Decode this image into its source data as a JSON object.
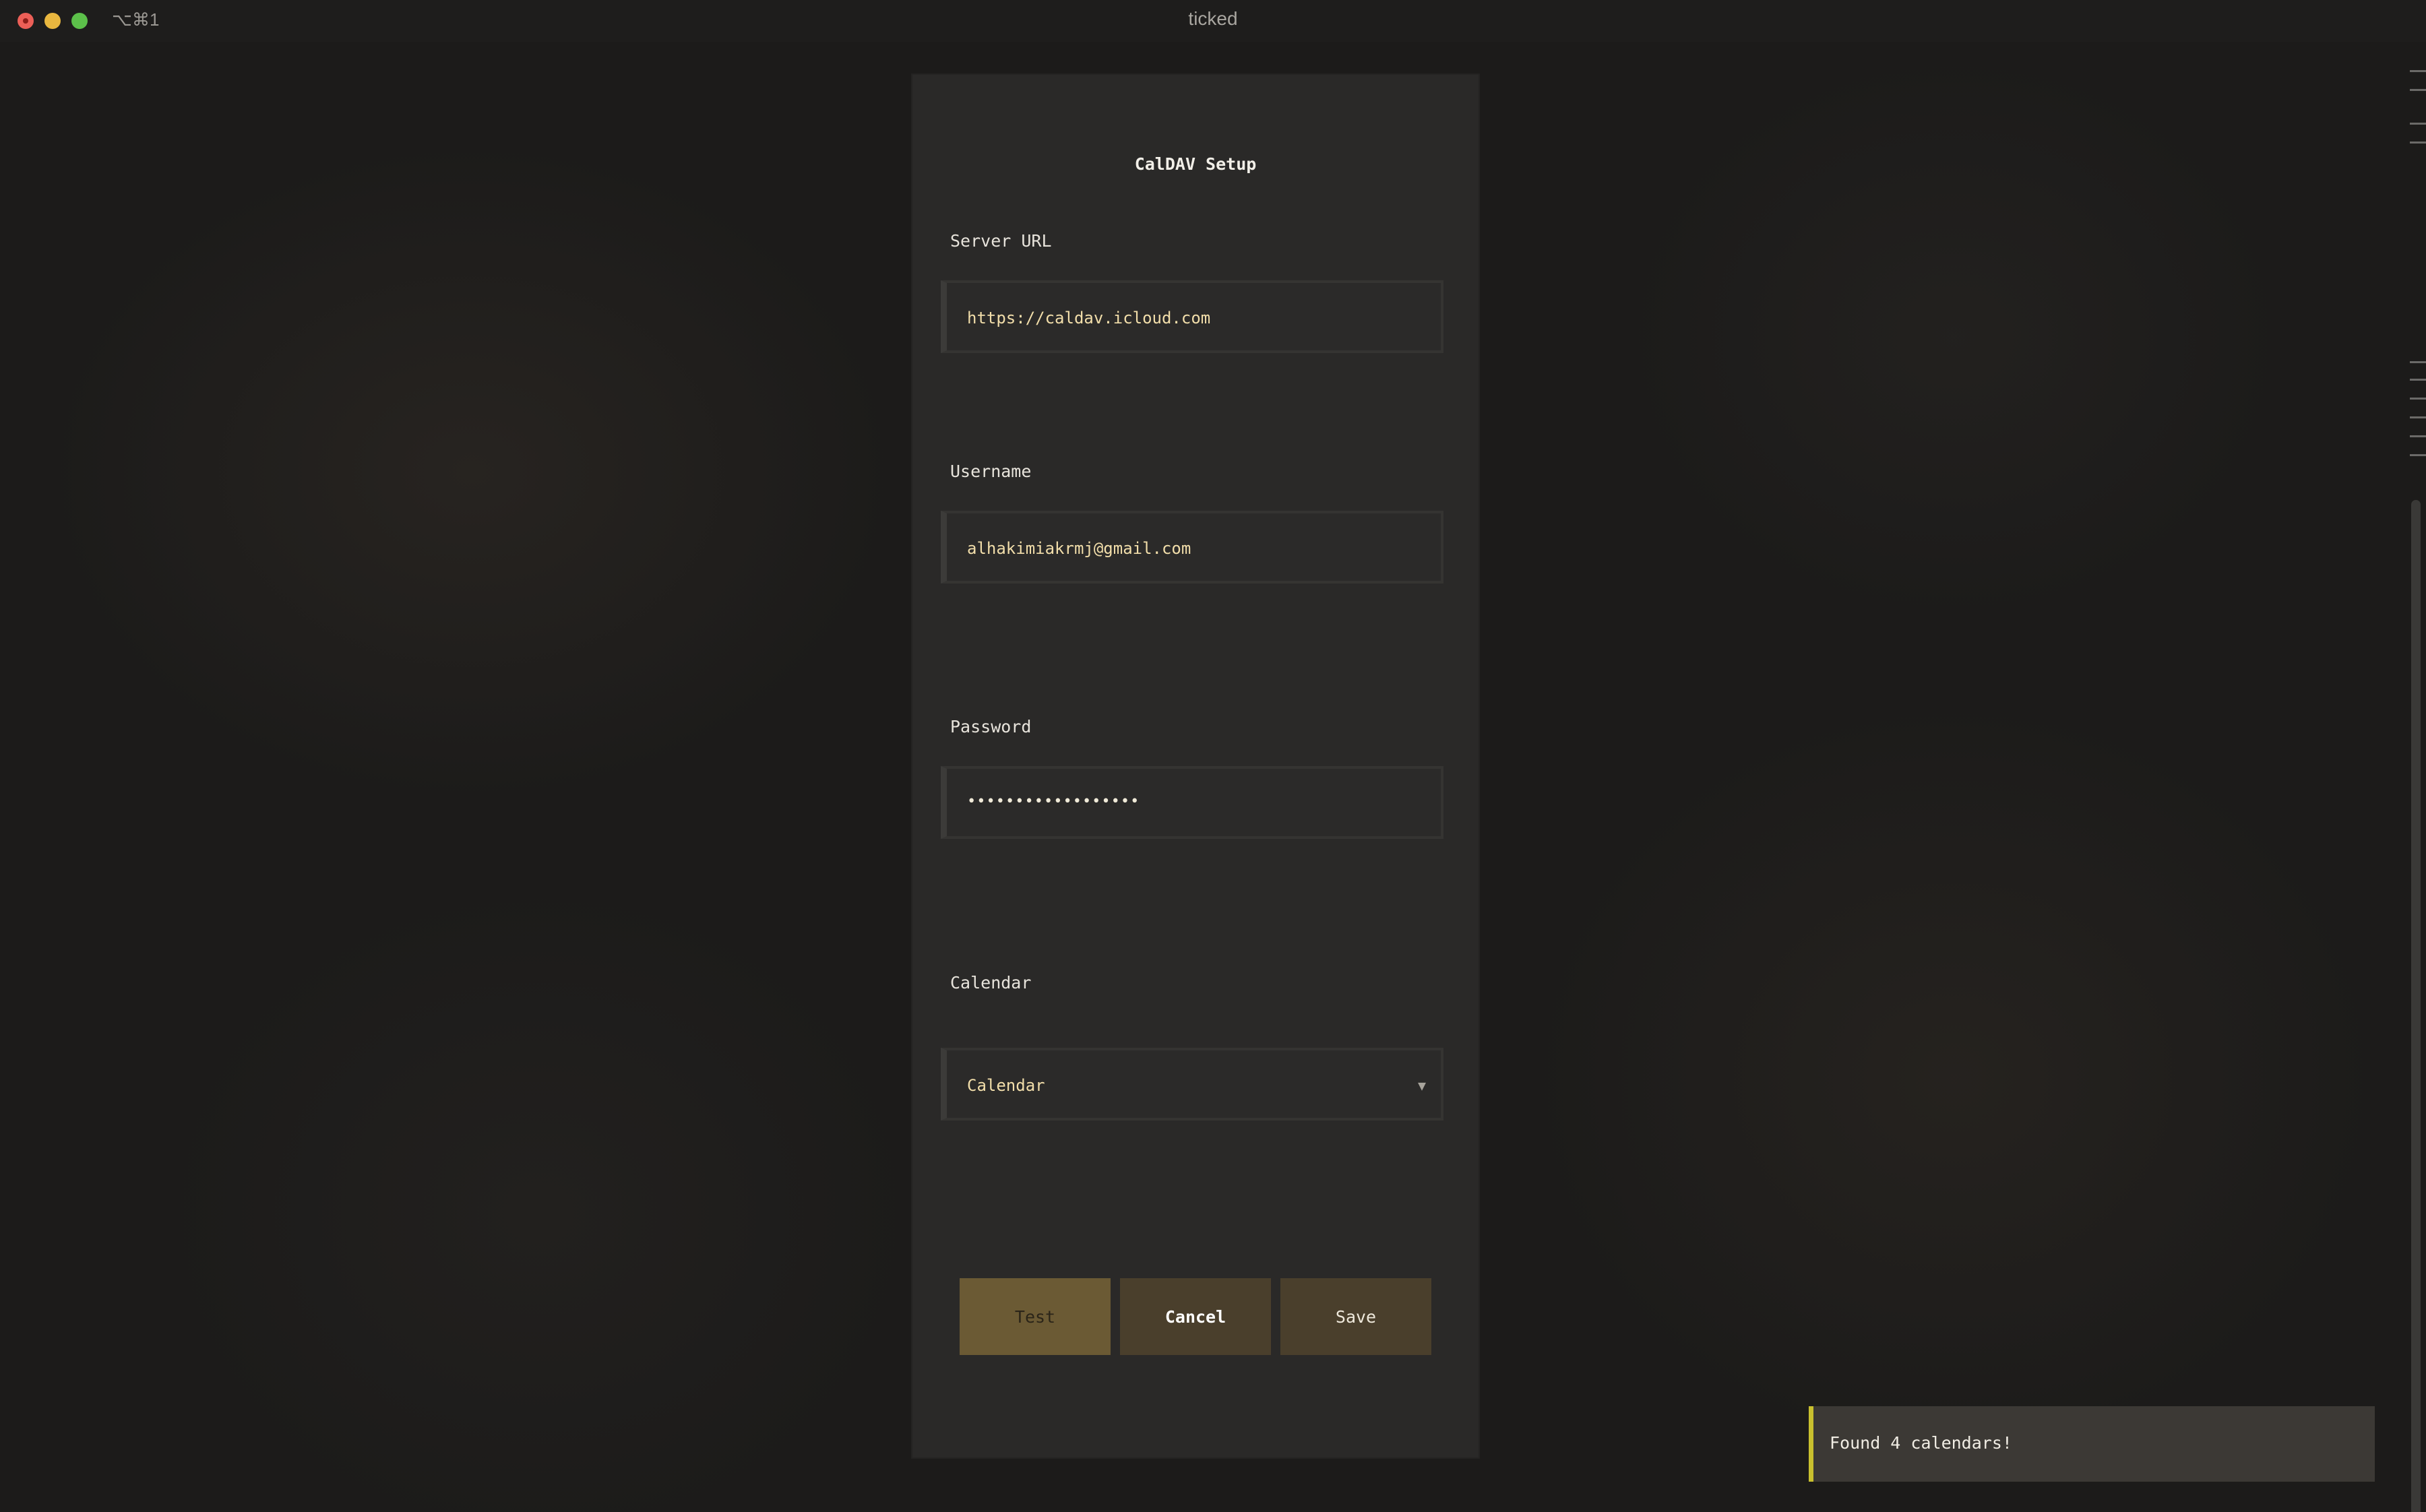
{
  "window": {
    "shortcut": "⌥⌘1",
    "title": "ticked"
  },
  "dialog": {
    "title": "CalDAV Setup",
    "server_url": {
      "label": "Server URL",
      "value": "https://caldav.icloud.com"
    },
    "username": {
      "label": "Username",
      "value": "alhakimiakrmj@gmail.com"
    },
    "password": {
      "label": "Password",
      "value": "••••••••••••••••••"
    },
    "calendar": {
      "label": "Calendar",
      "selected": "Calendar",
      "icon": "chevron-down-icon",
      "glyph": "▼"
    },
    "buttons": {
      "test": "Test",
      "cancel": "Cancel",
      "save": "Save"
    }
  },
  "toast": {
    "message": "Found 4 calendars!"
  },
  "colors": {
    "accent": "#c9c02e",
    "button": "#4a3f2c",
    "input_text": "#f2deaa"
  }
}
